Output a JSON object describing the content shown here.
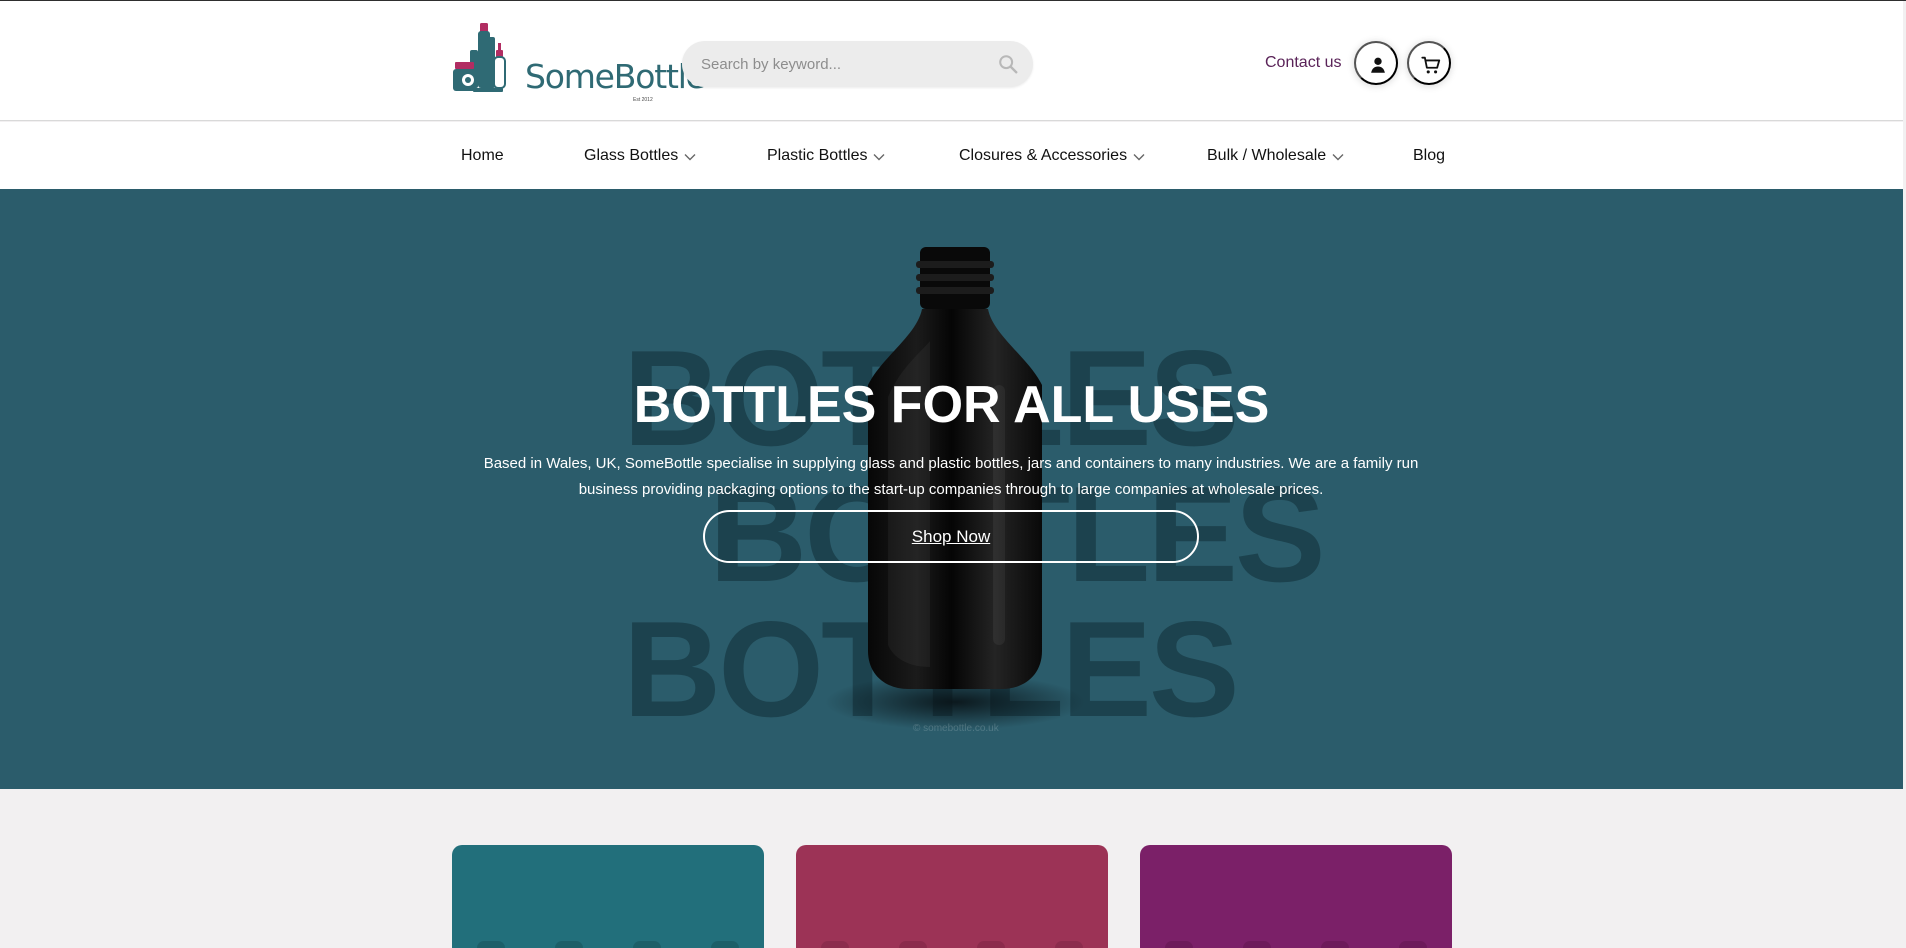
{
  "colors": {
    "brand_teal": "#2f6a74",
    "brand_magenta": "#b12d62",
    "hero_background": "#2b5c6b",
    "contact_link": "#5a2358",
    "card_teal": "#226f7b",
    "card_red": "#9c3356",
    "card_purple": "#7b2068"
  },
  "header": {
    "logo": {
      "brand_name": "SomeBottle",
      "established": "Est 2012"
    },
    "search": {
      "placeholder": "Search by keyword...",
      "icon": "search-icon"
    },
    "contact_label": "Contact us",
    "account_icon": "person-icon",
    "cart_icon": "cart-icon"
  },
  "nav": {
    "items": [
      {
        "label": "Home",
        "dropdown": false
      },
      {
        "label": "Glass Bottles",
        "dropdown": true
      },
      {
        "label": "Plastic Bottles",
        "dropdown": true
      },
      {
        "label": "Closures & Accessories",
        "dropdown": true
      },
      {
        "label": "Bulk / Wholesale",
        "dropdown": true
      },
      {
        "label": "Blog",
        "dropdown": false
      }
    ]
  },
  "hero": {
    "background_words": [
      "BOTTLES",
      "BOTTLES",
      "BOTTLES"
    ],
    "title": "BOTTLES FOR ALL USES",
    "description": "Based in Wales, UK, SomeBottle specialise in supplying glass and plastic bottles, jars and containers to many industries. We are a family run business providing packaging options to the start-up companies through to large companies at wholesale prices.",
    "watermark": "© somebottle.co.uk",
    "button_label": "Shop Now"
  },
  "cards": [
    {
      "color_name": "card_teal"
    },
    {
      "color_name": "card_red"
    },
    {
      "color_name": "card_purple"
    }
  ]
}
